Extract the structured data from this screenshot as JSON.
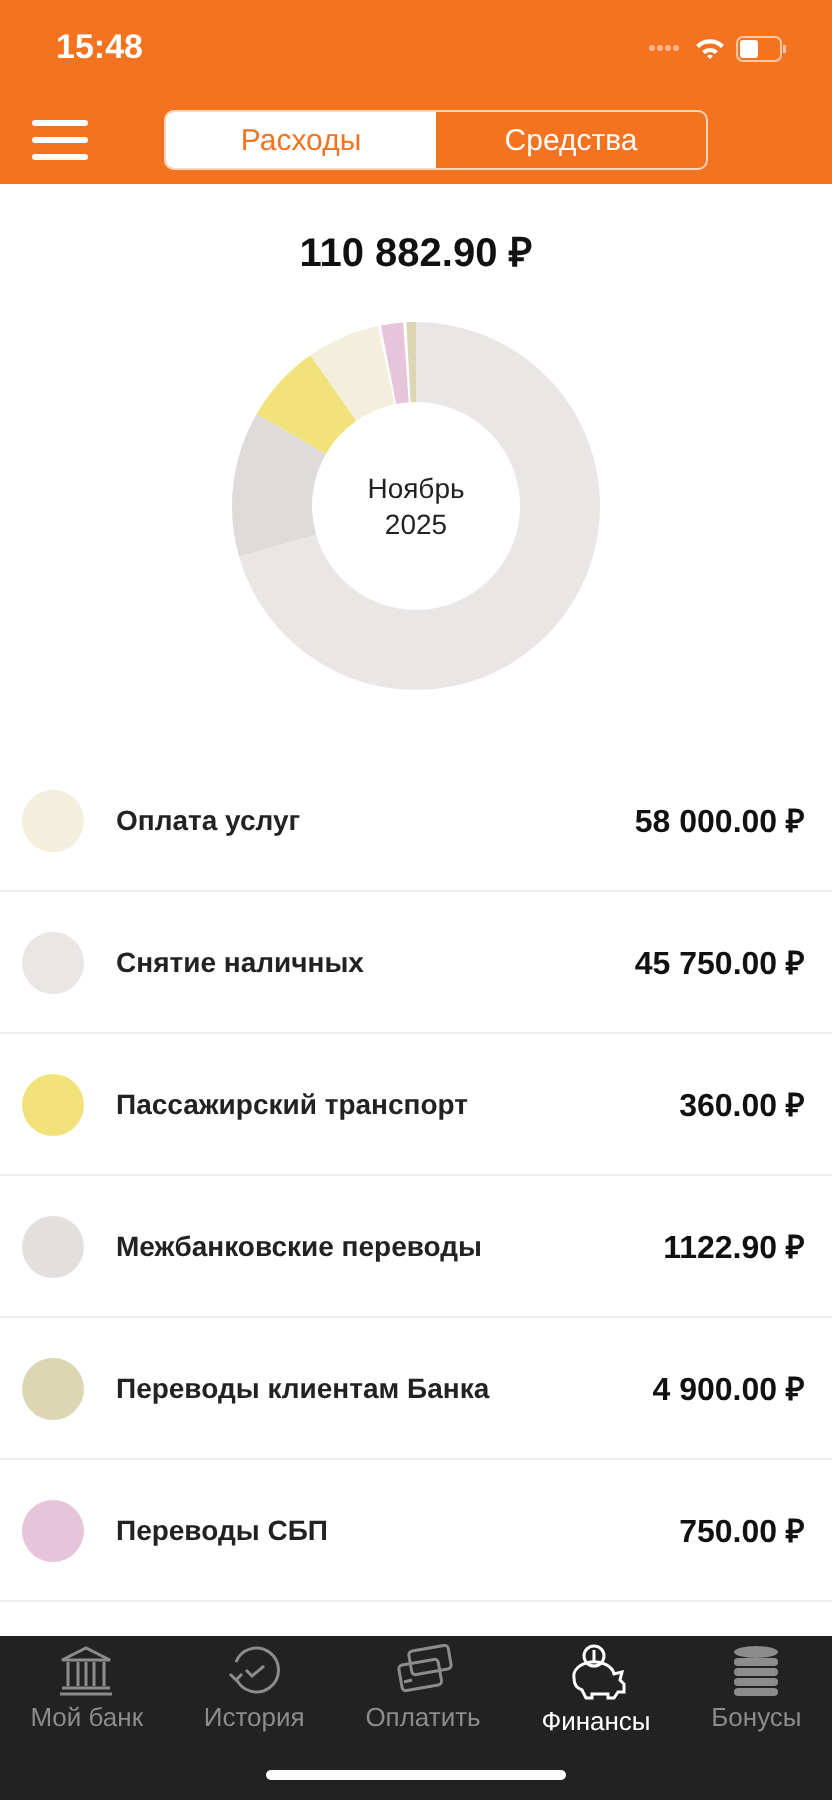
{
  "status_bar": {
    "time": "15:48"
  },
  "tabs": [
    {
      "label": "Расходы",
      "selected": true
    },
    {
      "label": "Средства",
      "selected": false
    }
  ],
  "total": "110 882.90 ₽",
  "chart_center": {
    "month": "Ноябрь",
    "year": "2025"
  },
  "categories": [
    {
      "name": "Оплата услуг",
      "amount": "58 000.00 ₽",
      "color": "#f3efdc"
    },
    {
      "name": "Снятие наличных",
      "amount": "45 750.00 ₽",
      "color": "#e9e6e5"
    },
    {
      "name": "Пассажирский транспорт",
      "amount": "360.00 ₽",
      "color": "#f2e27a"
    },
    {
      "name": "Межбанковские переводы",
      "amount": "1122.90 ₽",
      "color": "#e3dfdf"
    },
    {
      "name": "Переводы клиентам Банка",
      "amount": "4 900.00 ₽",
      "color": "#dcd6b4"
    },
    {
      "name": "Переводы СБП",
      "amount": "750.00 ₽",
      "color": "#e6c4d9"
    }
  ],
  "nav": [
    {
      "label": "Мой банк",
      "selected": false
    },
    {
      "label": "История",
      "selected": false
    },
    {
      "label": "Оплатить",
      "selected": false
    },
    {
      "label": "Финансы",
      "selected": true
    },
    {
      "label": "Бонусы",
      "selected": false
    }
  ]
}
